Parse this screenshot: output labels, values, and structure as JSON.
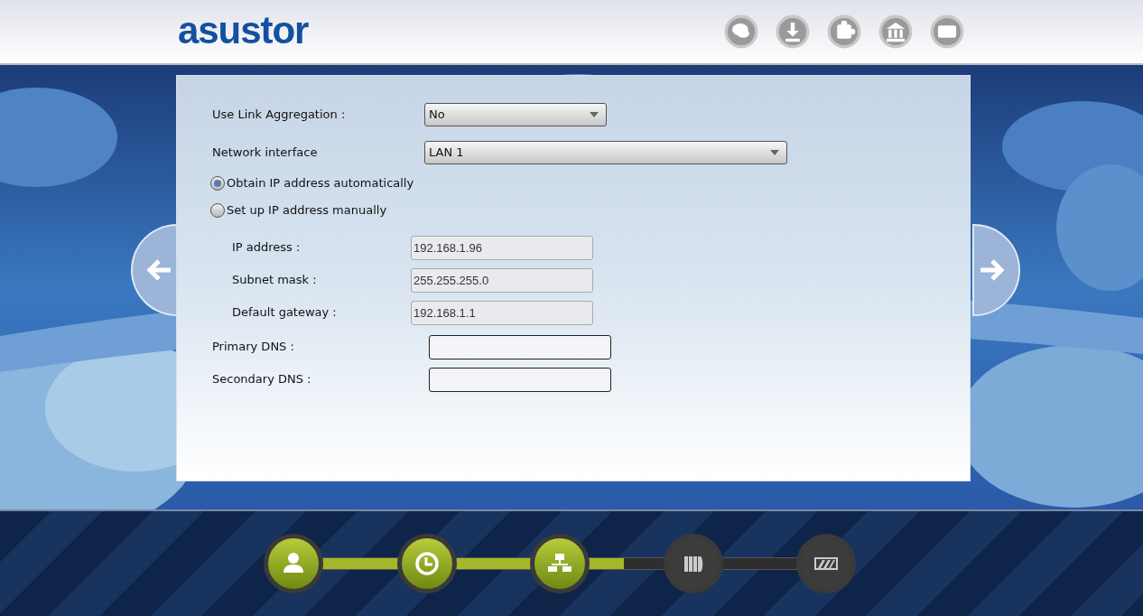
{
  "header": {
    "logo": "asustor",
    "icons": [
      {
        "kind": "chat"
      },
      {
        "kind": "download"
      },
      {
        "kind": "puzzle"
      },
      {
        "kind": "bank"
      },
      {
        "kind": "card"
      }
    ]
  },
  "form": {
    "link_aggregation": {
      "label": "Use Link Aggregation :",
      "value": "No"
    },
    "network_interface": {
      "label": "Network interface",
      "value": "LAN 1"
    },
    "ip_modes": [
      {
        "label": "Obtain IP address automatically",
        "selected": true
      },
      {
        "label": "Set up IP address manually",
        "selected": false
      }
    ],
    "manual_fields": [
      {
        "label": "IP address :",
        "value": "192.168.1.96",
        "disabled": true
      },
      {
        "label": "Subnet mask :",
        "value": "255.255.255.0",
        "disabled": true
      },
      {
        "label": "Default gateway :",
        "value": "192.168.1.1",
        "disabled": true
      }
    ],
    "dns_fields": [
      {
        "label": "Primary DNS :",
        "disabled": false
      },
      {
        "label": "Secondary DNS :",
        "disabled": false
      }
    ]
  },
  "steps": {
    "level": 0.62,
    "items": [
      {
        "kind": "user",
        "done": true
      },
      {
        "kind": "clock",
        "done": true
      },
      {
        "kind": "network",
        "done": true
      },
      {
        "kind": "drives",
        "done": false
      },
      {
        "kind": "storage",
        "done": false
      }
    ]
  }
}
